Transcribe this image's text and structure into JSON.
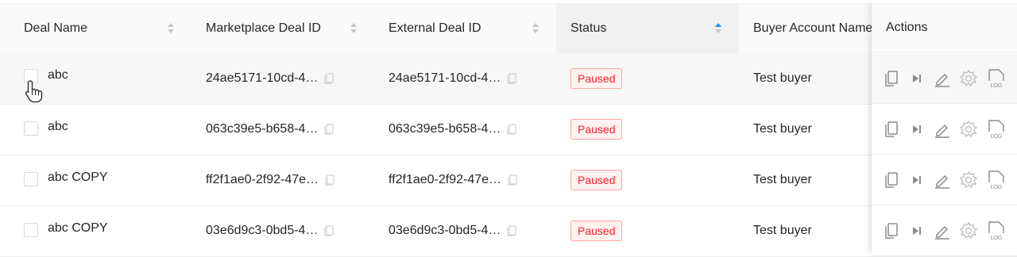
{
  "columns": {
    "deal_name": "Deal Name",
    "marketplace_deal_id": "Marketplace Deal ID",
    "external_deal_id": "External Deal ID",
    "status": "Status",
    "buyer_account_name": "Buyer Account Name",
    "actions": "Actions"
  },
  "rows": [
    {
      "deal_name": "abc",
      "marketplace_deal_id": "24ae5171-10cd-4…",
      "external_deal_id": "24ae5171-10cd-4…",
      "status": "Paused",
      "buyer": "Test buyer"
    },
    {
      "deal_name": "abc",
      "marketplace_deal_id": "063c39e5-b658-4…",
      "external_deal_id": "063c39e5-b658-4…",
      "status": "Paused",
      "buyer": "Test buyer"
    },
    {
      "deal_name": "abc COPY",
      "marketplace_deal_id": "ff2f1ae0-2f92-47e…",
      "external_deal_id": "ff2f1ae0-2f92-47e…",
      "status": "Paused",
      "buyer": "Test buyer"
    },
    {
      "deal_name": "abc COPY",
      "marketplace_deal_id": "03e6d9c3-0bd5-4…",
      "external_deal_id": "03e6d9c3-0bd5-4…",
      "status": "Paused",
      "buyer": "Test buyer"
    }
  ],
  "icons": {
    "copy": "copy-icon",
    "play": "play-icon",
    "edit": "edit-icon",
    "settings": "gear-icon",
    "log": "log-icon",
    "log_text": "LOG",
    "cursor": "pointer-cursor-icon"
  },
  "colors": {
    "sort_active": "#1890ff",
    "sort_inactive": "#c4c4c4",
    "status_paused_text": "#f5222d",
    "status_paused_bg": "#fff1f0",
    "status_paused_border": "#ffa39e"
  },
  "sort": {
    "column": "status",
    "direction": "ascending"
  }
}
